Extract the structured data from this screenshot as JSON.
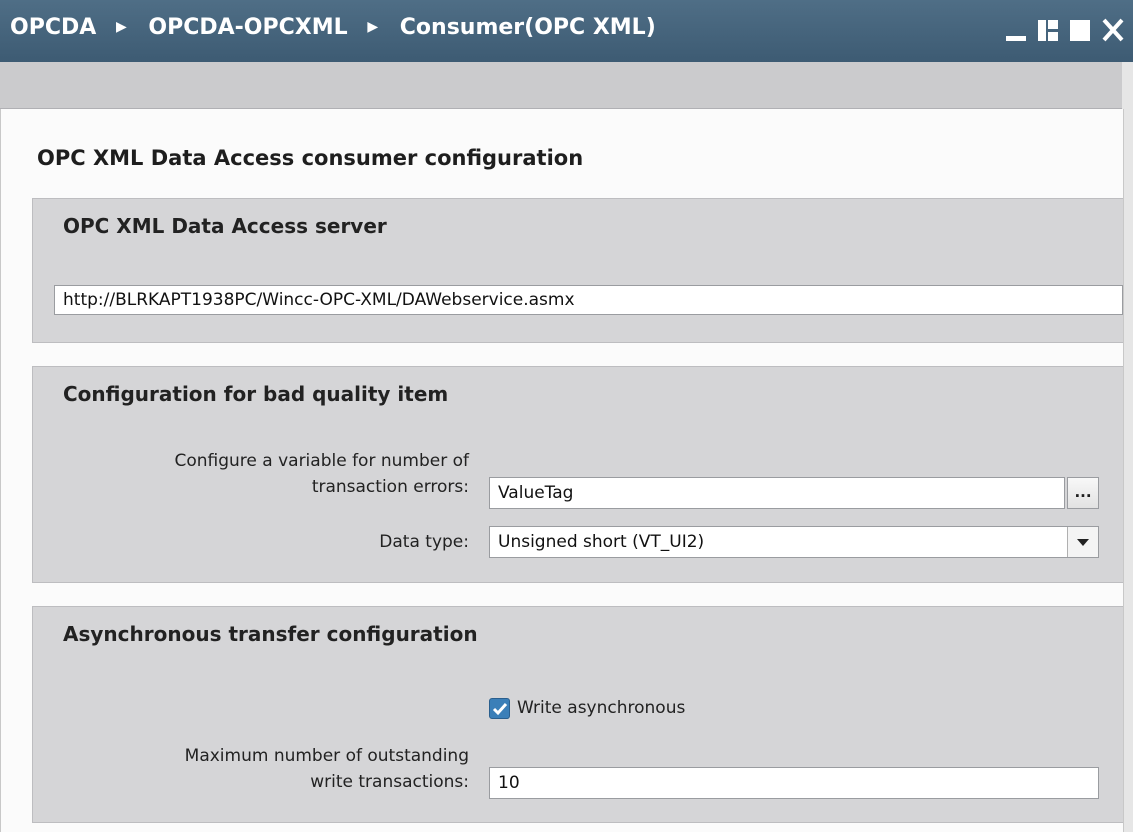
{
  "window": {
    "breadcrumb": [
      "OPCDA",
      "OPCDA-OPCXML",
      "Consumer(OPC XML)"
    ],
    "breadcrumb_separator_icon": "triangle-right-icon",
    "controls": [
      "minimize-icon",
      "restore-icon",
      "maximize-icon",
      "close-icon"
    ]
  },
  "page": {
    "title": "OPC XML Data Access consumer configuration"
  },
  "server_section": {
    "title": "OPC XML Data Access server",
    "url": "http://BLRKAPT1938PC/Wincc-OPC-XML/DAWebservice.asmx"
  },
  "bad_quality_section": {
    "title": "Configuration for bad quality item",
    "variable_label_line1": "Configure a variable for number of",
    "variable_label_line2": "transaction errors:",
    "variable_value": "ValueTag",
    "browse_label": "...",
    "data_type_label": "Data type:",
    "data_type_value": "Unsigned short (VT_UI2)"
  },
  "async_section": {
    "title": "Asynchronous transfer configuration",
    "write_async_label": "Write asynchronous",
    "write_async_checked": true,
    "max_label_line1": "Maximum number of outstanding",
    "max_label_line2": "write transactions:",
    "max_value": "10"
  }
}
